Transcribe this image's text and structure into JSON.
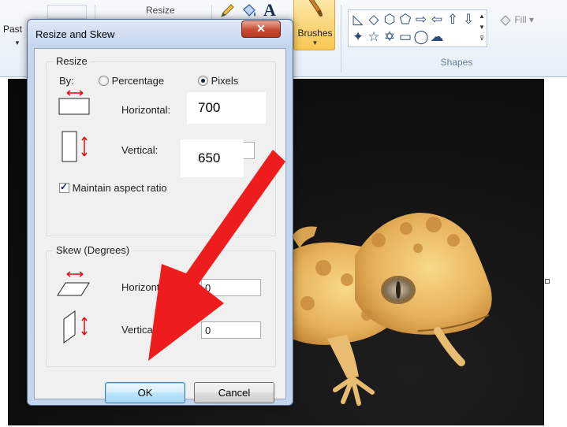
{
  "ribbon": {
    "paste_fragment": "Past",
    "hidden_resize_fragment": "Resize",
    "text_tool_glyph": "A",
    "brushes_label": "Brushes",
    "shapes_group_label": "Shapes",
    "fill_label": "Fill",
    "shape_glyphs": [
      "◺",
      "◇",
      "⬡",
      "⬠",
      "⇨",
      "⇦",
      "⇧",
      "⇩",
      "✦",
      "☆",
      "✡",
      "▭",
      "◯",
      "☁"
    ]
  },
  "dialog": {
    "title": "Resize and Skew",
    "close_glyph": "✕",
    "resize": {
      "legend": "Resize",
      "by_label": "By:",
      "percentage_label": "Percentage",
      "pixels_label": "Pixels",
      "selected_mode": "Pixels",
      "horizontal_label": "Horizontal:",
      "horizontal_value": "700",
      "vertical_label": "Vertical:",
      "vertical_value": "650",
      "maintain_aspect_label": "Maintain aspect ratio",
      "maintain_aspect_checked": true
    },
    "skew": {
      "legend": "Skew (Degrees)",
      "horizontal_label": "Horizontal:",
      "horizontal_value": "0",
      "vertical_label": "Vertical:",
      "vertical_value": "0"
    },
    "ok_label": "OK",
    "cancel_label": "Cancel"
  },
  "colors": {
    "arrow": "#ee1c1c",
    "dialog_frame": "#c4d6ec",
    "close_button": "#c74a31"
  }
}
